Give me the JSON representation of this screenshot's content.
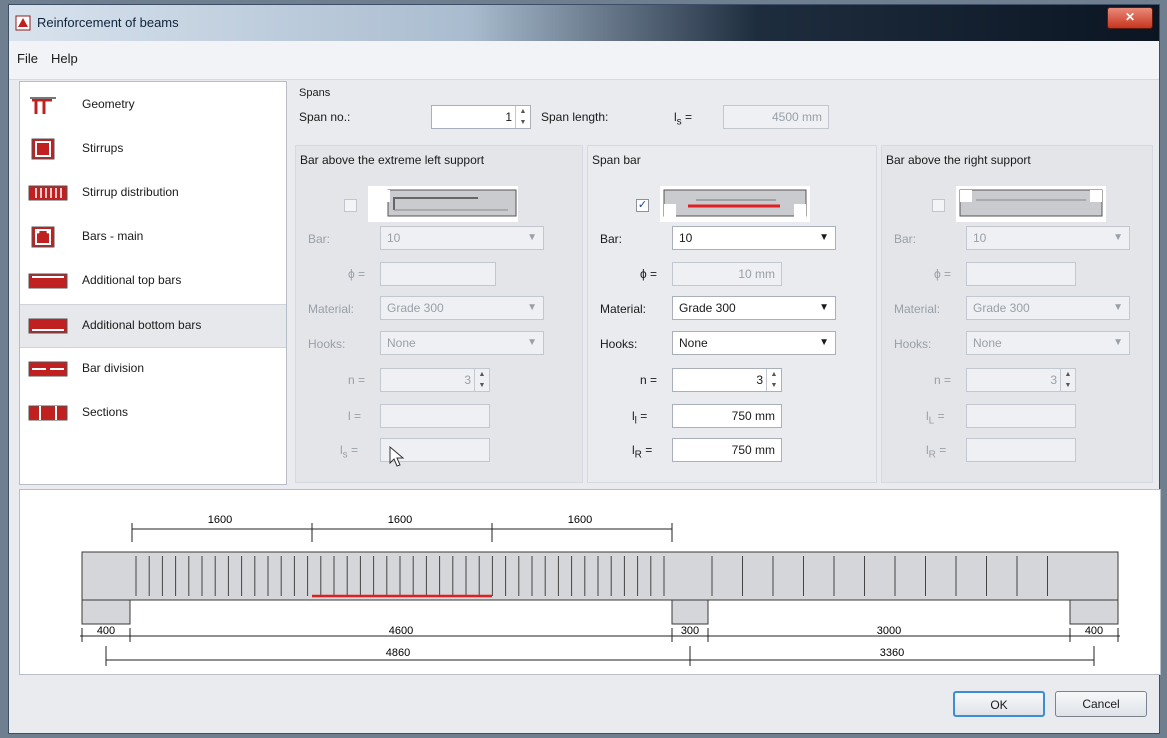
{
  "window": {
    "title": "Reinforcement of beams"
  },
  "menu": [
    "File",
    "Help"
  ],
  "nav": [
    {
      "label": "Geometry",
      "icon": "beam-geometry-icon"
    },
    {
      "label": "Stirrups",
      "icon": "stirrup-icon"
    },
    {
      "label": "Stirrup distribution",
      "icon": "stirrup-distribution-icon"
    },
    {
      "label": "Bars - main",
      "icon": "main-bars-icon"
    },
    {
      "label": "Additional top bars",
      "icon": "top-bars-icon"
    },
    {
      "label": "Additional bottom bars",
      "icon": "bottom-bars-icon",
      "selected": true
    },
    {
      "label": "Bar division",
      "icon": "bar-division-icon"
    },
    {
      "label": "Sections",
      "icon": "sections-icon"
    }
  ],
  "spans": {
    "group_label": "Spans",
    "span_no_label": "Span no.:",
    "span_no_value": "1",
    "span_length_label": "Span length:",
    "ls_label": "l",
    "ls_sub": "s",
    "ls_eq": "=",
    "span_length_value": "4500 mm"
  },
  "left": {
    "title": "Bar above the extreme left support",
    "checked": false,
    "bar_label": "Bar:",
    "bar_value": "10",
    "phi_label": "ϕ =",
    "phi_value": "",
    "material_label": "Material:",
    "material_value": "Grade 300",
    "hooks_label": "Hooks:",
    "hooks_value": "None",
    "n_label": "n =",
    "n_value": "3",
    "l_label": "l =",
    "l_value": "",
    "ls_label": "l",
    "ls_sub": "s",
    "ls_eq": "=",
    "ls_value": ""
  },
  "span": {
    "title": "Span bar",
    "checked": true,
    "bar_label": "Bar:",
    "bar_value": "10",
    "phi_label": "ϕ =",
    "phi_value": "10 mm",
    "material_label": "Material:",
    "material_value": "Grade 300",
    "hooks_label": "Hooks:",
    "hooks_value": "None",
    "n_label": "n =",
    "n_value": "3",
    "ll_label": "l",
    "ll_sub": "l",
    "ll_eq": "=",
    "ll_value": "750 mm",
    "lr_label": "l",
    "lr_sub": "R",
    "lr_eq": "=",
    "lr_value": "750 mm"
  },
  "right": {
    "title": "Bar above the right support",
    "checked": false,
    "bar_label": "Bar:",
    "bar_value": "10",
    "phi_label": "ϕ =",
    "phi_value": "",
    "material_label": "Material:",
    "material_value": "Grade 300",
    "hooks_label": "Hooks:",
    "hooks_value": "None",
    "n_label": "n =",
    "n_value": "3",
    "ll_label": "l",
    "ll_sub": "L",
    "ll_eq": "=",
    "ll_value": "",
    "lr_label": "l",
    "lr_sub": "R",
    "lr_eq": "=",
    "lr_value": ""
  },
  "drawing": {
    "top_dims": [
      "1600",
      "1600",
      "1600"
    ],
    "bottom_dims_row1": [
      "400",
      "4600",
      "300",
      "3000",
      "400"
    ],
    "bottom_dims_row2": [
      "4860",
      "3360"
    ]
  },
  "buttons": {
    "ok": "OK",
    "cancel": "Cancel"
  },
  "colors": {
    "accent_bar": "#e02020",
    "concrete": "#d4d6d9",
    "beam_outline": "#3a3a3a"
  }
}
